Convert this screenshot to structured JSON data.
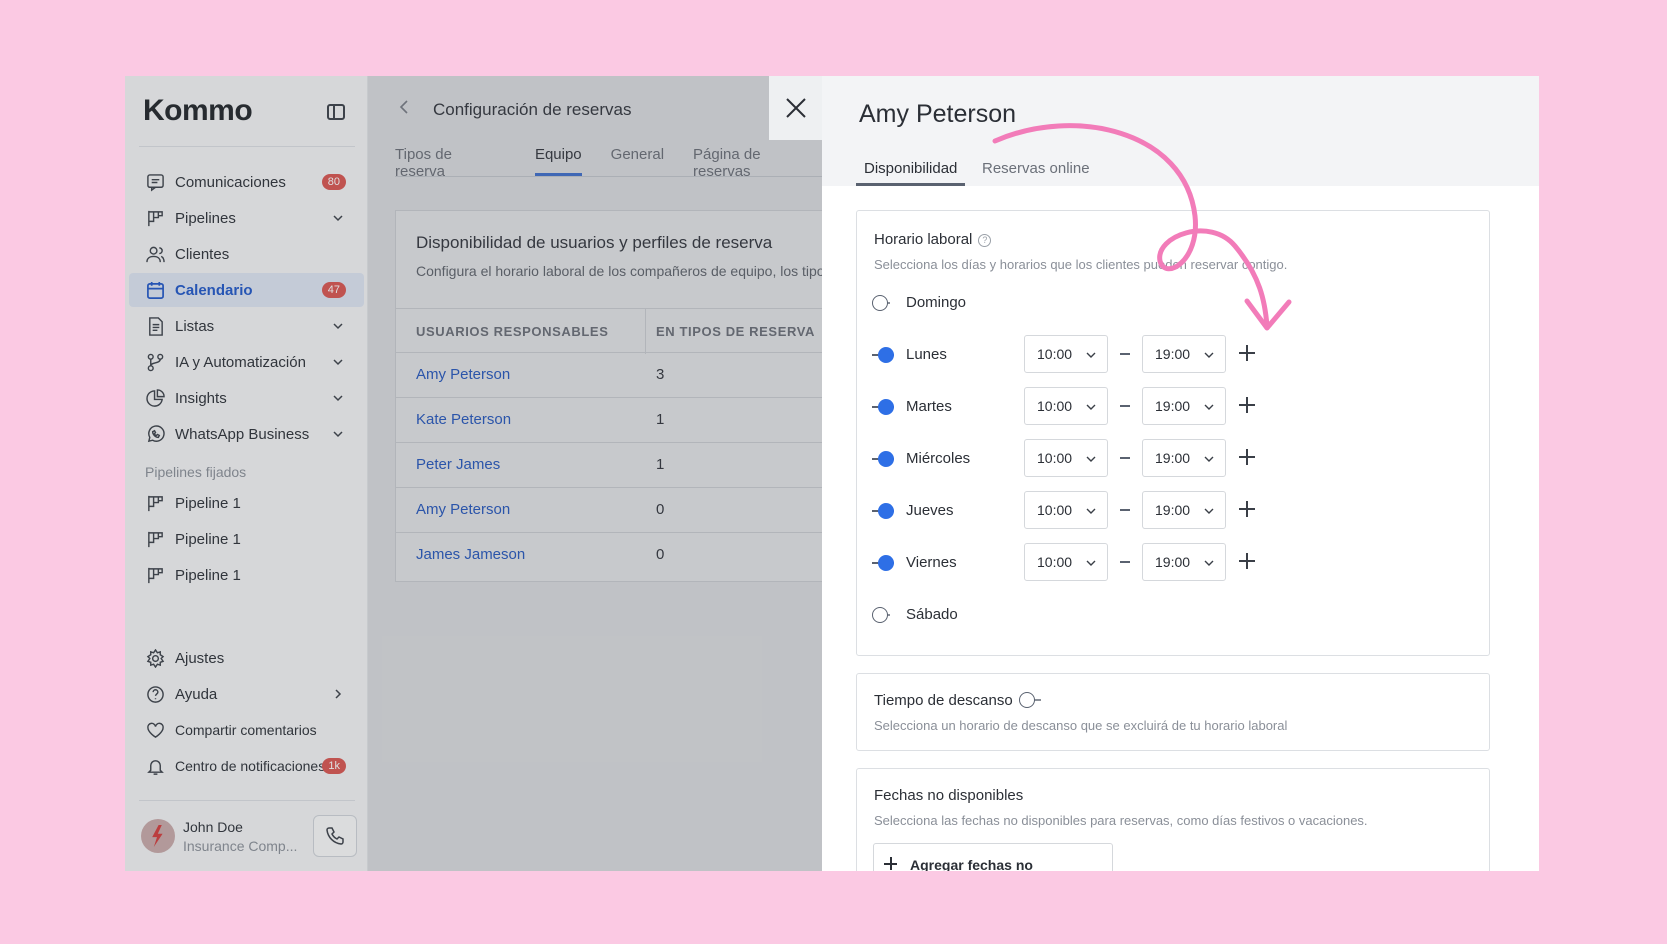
{
  "sidebar": {
    "logo": "Kommo",
    "items": [
      {
        "label": "Comunicaciones",
        "badge": "80",
        "icon": "chat-icon"
      },
      {
        "label": "Pipelines",
        "icon": "pipeline-icon"
      },
      {
        "label": "Clientes",
        "icon": "users-icon"
      },
      {
        "label": "Calendario",
        "badge": "47",
        "icon": "calendar-icon"
      },
      {
        "label": "Listas",
        "icon": "list-icon"
      },
      {
        "label": "IA y Automatización",
        "icon": "automation-icon"
      },
      {
        "label": "Insights",
        "icon": "chart-icon"
      },
      {
        "label": "WhatsApp Business",
        "icon": "whatsapp-icon"
      }
    ],
    "pinned_title": "Pipelines fijados",
    "pinned": [
      {
        "label": "Pipeline 1"
      },
      {
        "label": "Pipeline 1"
      },
      {
        "label": "Pipeline 1"
      }
    ],
    "bottom": [
      {
        "label": "Ajustes",
        "icon": "gear-icon"
      },
      {
        "label": "Ayuda",
        "icon": "help-icon"
      },
      {
        "label": "Compartir comentarios",
        "icon": "heart-icon"
      },
      {
        "label": "Centro de notificaciones",
        "badge": "1k",
        "icon": "bell-icon"
      }
    ],
    "user": {
      "name": "John Doe",
      "company": "Insurance Comp..."
    }
  },
  "middle": {
    "title": "Configuración de reservas",
    "tabs": [
      "Tipos de reserva",
      "Equipo",
      "General",
      "Página de reservas"
    ],
    "active_tab": "Equipo",
    "card_title": "Disponibilidad de usuarios y perfiles de reserva",
    "card_sub": "Configura el horario laboral de los compañeros de equipo, los tipos",
    "columns": [
      "USUARIOS RESPONSABLES",
      "EN TIPOS DE RESERVA"
    ],
    "rows": [
      {
        "name": "Amy Peterson",
        "count": "3"
      },
      {
        "name": "Kate Peterson",
        "count": "1"
      },
      {
        "name": "Peter James",
        "count": "1"
      },
      {
        "name": "Amy Peterson",
        "count": "0"
      },
      {
        "name": "James Jameson",
        "count": "0"
      }
    ]
  },
  "panel": {
    "name": "Amy Peterson",
    "tabs": [
      "Disponibilidad",
      "Reservas online"
    ],
    "work": {
      "title": "Horario laboral",
      "sub": "Selecciona los días y horarios que los clientes pueden reservar contigo.",
      "days": [
        {
          "name": "Domingo",
          "enabled": false
        },
        {
          "name": "Lunes",
          "enabled": true,
          "from": "10:00",
          "to": "19:00"
        },
        {
          "name": "Martes",
          "enabled": true,
          "from": "10:00",
          "to": "19:00"
        },
        {
          "name": "Miércoles",
          "enabled": true,
          "from": "10:00",
          "to": "19:00"
        },
        {
          "name": "Jueves",
          "enabled": true,
          "from": "10:00",
          "to": "19:00"
        },
        {
          "name": "Viernes",
          "enabled": true,
          "from": "10:00",
          "to": "19:00"
        },
        {
          "name": "Sábado",
          "enabled": false
        }
      ]
    },
    "break": {
      "title": "Tiempo de descanso",
      "sub": "Selecciona un horario de descanso que se excluirá de tu horario laboral",
      "enabled": false
    },
    "unavailable": {
      "title": "Fechas no disponibles",
      "sub": "Selecciona las fechas no disponibles para reservas, como días festivos o vacaciones.",
      "button": "Agregar fechas no disponibles"
    }
  },
  "colors": {
    "accent": "#2e6fe6",
    "background": "#fbc9e3",
    "annotation": "#f27cb9",
    "badge": "#d9534f"
  }
}
